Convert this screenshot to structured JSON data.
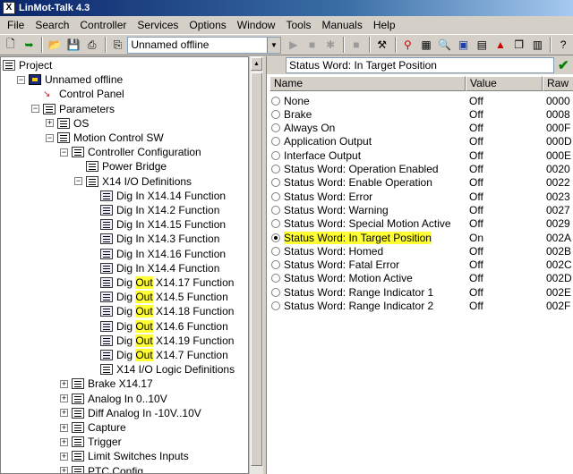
{
  "window": {
    "title": "LinMot-Talk 4.3",
    "icon": "linmot-app-icon"
  },
  "menu": [
    "File",
    "Search",
    "Controller",
    "Services",
    "Options",
    "Window",
    "Tools",
    "Manuals",
    "Help"
  ],
  "toolbar": {
    "drive_select": "Unnamed offline"
  },
  "tree": [
    {
      "label": "Project",
      "level": 0,
      "toggle": "",
      "icon": "project-icon"
    },
    {
      "label": "Unnamed offline",
      "level": 1,
      "toggle": "-",
      "icon": "drive-unit-icon"
    },
    {
      "label": "Control Panel",
      "level": 2,
      "toggle": "",
      "icon": "control-panel-icon"
    },
    {
      "label": "Parameters",
      "level": 2,
      "toggle": "-",
      "icon": "parameters-icon"
    },
    {
      "label": "OS",
      "level": 3,
      "toggle": "+",
      "icon": "folder-icon"
    },
    {
      "label": "Motion Control SW",
      "level": 3,
      "toggle": "-",
      "icon": "folder-icon"
    },
    {
      "label": "Controller Configuration",
      "level": 4,
      "toggle": "-",
      "icon": "folder-icon"
    },
    {
      "label": "Power Bridge",
      "level": 5,
      "toggle": "",
      "icon": "folder-icon"
    },
    {
      "label": "X14 I/O Definitions",
      "level": 5,
      "toggle": "-",
      "icon": "folder-icon"
    },
    {
      "label": "Dig In X14.14 Function",
      "level": 6,
      "toggle": "",
      "icon": "parameter-icon"
    },
    {
      "label": "Dig In X14.2 Function",
      "level": 6,
      "toggle": "",
      "icon": "parameter-icon"
    },
    {
      "label": "Dig In X14.15 Function",
      "level": 6,
      "toggle": "",
      "icon": "parameter-icon"
    },
    {
      "label": "Dig In X14.3 Function",
      "level": 6,
      "toggle": "",
      "icon": "parameter-icon"
    },
    {
      "label": "Dig In X14.16 Function",
      "level": 6,
      "toggle": "",
      "icon": "parameter-icon"
    },
    {
      "label": "Dig In X14.4 Function",
      "level": 6,
      "toggle": "",
      "icon": "parameter-icon"
    },
    {
      "label": "Dig Out X14.17 Function",
      "level": 6,
      "toggle": "",
      "icon": "parameter-icon",
      "hl": true
    },
    {
      "label": "Dig Out X14.5 Function",
      "level": 6,
      "toggle": "",
      "icon": "parameter-icon",
      "hl": true
    },
    {
      "label": "Dig Out X14.18 Function",
      "level": 6,
      "toggle": "",
      "icon": "parameter-icon",
      "hl": true
    },
    {
      "label": "Dig Out X14.6 Function",
      "level": 6,
      "toggle": "",
      "icon": "parameter-icon",
      "hl": true
    },
    {
      "label": "Dig Out X14.19 Function",
      "level": 6,
      "toggle": "",
      "icon": "parameter-icon",
      "hl": true
    },
    {
      "label": "Dig Out X14.7 Function",
      "level": 6,
      "toggle": "",
      "icon": "parameter-icon",
      "hl": true
    },
    {
      "label": "X14 I/O Logic Definitions",
      "level": 6,
      "toggle": "",
      "icon": "folder-icon"
    },
    {
      "label": "Brake X14.17",
      "level": 4,
      "toggle": "+",
      "icon": "folder-icon"
    },
    {
      "label": "Analog In 0..10V",
      "level": 4,
      "toggle": "+",
      "icon": "folder-icon"
    },
    {
      "label": "Diff Analog In -10V..10V",
      "level": 4,
      "toggle": "+",
      "icon": "folder-icon"
    },
    {
      "label": "Capture",
      "level": 4,
      "toggle": "+",
      "icon": "folder-icon"
    },
    {
      "label": "Trigger",
      "level": 4,
      "toggle": "+",
      "icon": "folder-icon"
    },
    {
      "label": "Limit Switches Inputs",
      "level": 4,
      "toggle": "+",
      "icon": "folder-icon"
    },
    {
      "label": "PTC Config",
      "level": 4,
      "toggle": "+",
      "icon": "folder-icon"
    }
  ],
  "right": {
    "address": "Status Word: In Target Position",
    "columns": [
      "Name",
      "Value",
      "Raw"
    ],
    "rows": [
      {
        "name": "None",
        "value": "Off",
        "raw": "0000",
        "selected": false
      },
      {
        "name": "Brake",
        "value": "Off",
        "raw": "0008",
        "selected": false
      },
      {
        "name": "Always On",
        "value": "Off",
        "raw": "000F",
        "selected": false
      },
      {
        "name": "Application Output",
        "value": "Off",
        "raw": "000D",
        "selected": false
      },
      {
        "name": "Interface Output",
        "value": "Off",
        "raw": "000E",
        "selected": false
      },
      {
        "name": "Status Word: Operation Enabled",
        "value": "Off",
        "raw": "0020",
        "selected": false
      },
      {
        "name": "Status Word: Enable Operation",
        "value": "Off",
        "raw": "0022",
        "selected": false
      },
      {
        "name": "Status Word: Error",
        "value": "Off",
        "raw": "0023",
        "selected": false
      },
      {
        "name": "Status Word: Warning",
        "value": "Off",
        "raw": "0027",
        "selected": false
      },
      {
        "name": "Status Word: Special Motion Active",
        "value": "Off",
        "raw": "0029",
        "selected": false
      },
      {
        "name": "Status Word: In Target Position",
        "value": "On",
        "raw": "002A",
        "selected": true
      },
      {
        "name": "Status Word: Homed",
        "value": "Off",
        "raw": "002B",
        "selected": false
      },
      {
        "name": "Status Word: Fatal Error",
        "value": "Off",
        "raw": "002C",
        "selected": false
      },
      {
        "name": "Status Word: Motion Active",
        "value": "Off",
        "raw": "002D",
        "selected": false
      },
      {
        "name": "Status Word: Range Indicator 1",
        "value": "Off",
        "raw": "002E",
        "selected": false
      },
      {
        "name": "Status Word: Range Indicator 2",
        "value": "Off",
        "raw": "002F",
        "selected": false
      }
    ]
  },
  "colors": {
    "highlight": "#ffff33",
    "title_bar": "#0a246a",
    "check_green": "#008000"
  }
}
